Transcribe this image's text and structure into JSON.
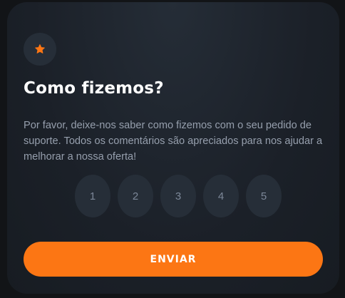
{
  "card": {
    "icon": "star-icon",
    "title": "Como fizemos?",
    "description": "Por favor, deixe-nos saber como fizemos com o seu pedido de suporte. Todos os comentários são apreciados para nos ajudar a melhorar a nossa oferta!",
    "ratings": [
      "1",
      "2",
      "3",
      "4",
      "5"
    ],
    "submit_label": "ENVIAR"
  },
  "colors": {
    "accent": "#fc7614",
    "background": "#121417",
    "card": "#1f2530",
    "rating_button": "#262e38",
    "text_muted": "#969fad",
    "title": "#ffffff"
  }
}
